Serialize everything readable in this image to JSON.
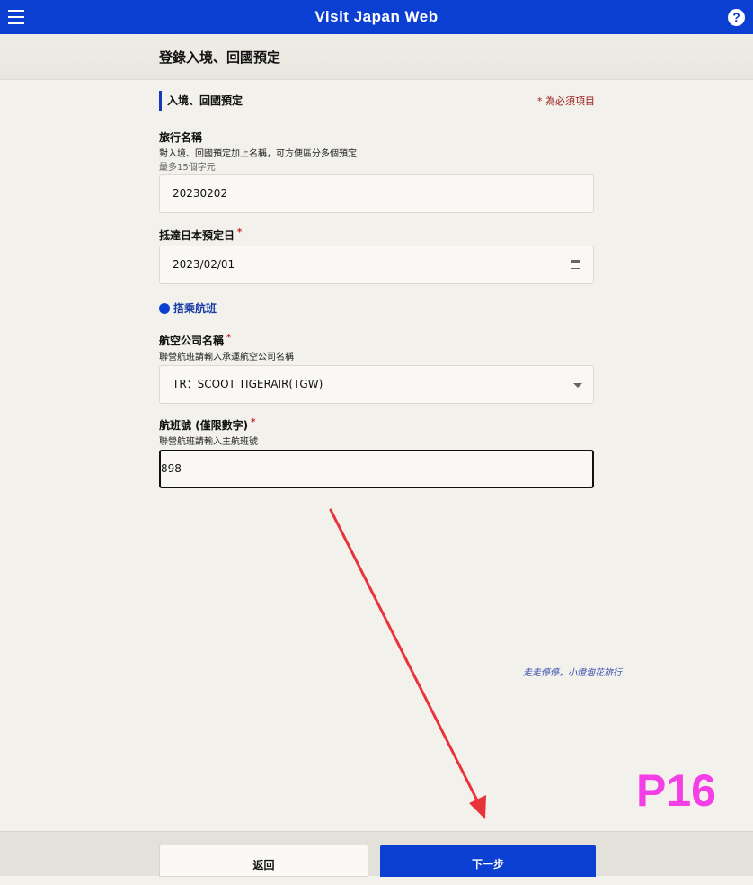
{
  "app": {
    "title": "Visit Japan Web"
  },
  "page": {
    "title": "登錄入境、回國預定"
  },
  "section": {
    "heading": "入境、回國預定",
    "required_note": "* 為必須項目"
  },
  "trip_name": {
    "label": "旅行名稱",
    "hint": "對入境、回國預定加上名稱，可方便區分多個預定",
    "limit": "最多15個字元",
    "value": "20230202"
  },
  "arrival_date": {
    "label": "抵達日本預定日",
    "value": "2023/02/01"
  },
  "flight": {
    "heading": "搭乘航班",
    "airline": {
      "label": "航空公司名稱",
      "hint": "聯營航班請輸入承運航空公司名稱",
      "value": "TR：SCOOT TIGERAIR(TGW)"
    },
    "number": {
      "label": "航班號 (僅限數字)",
      "hint": "聯營航班請輸入主航班號",
      "value": "898"
    }
  },
  "required_mark": "*",
  "watermark": "走走停停，小燈泡花旅行",
  "stamp": "P16",
  "footer": {
    "back_label": "返回",
    "next_label": "下一步"
  },
  "colors": {
    "brand": "#0a3fd1",
    "arrow": "#e8333a",
    "stamp": "#f43ee6"
  }
}
